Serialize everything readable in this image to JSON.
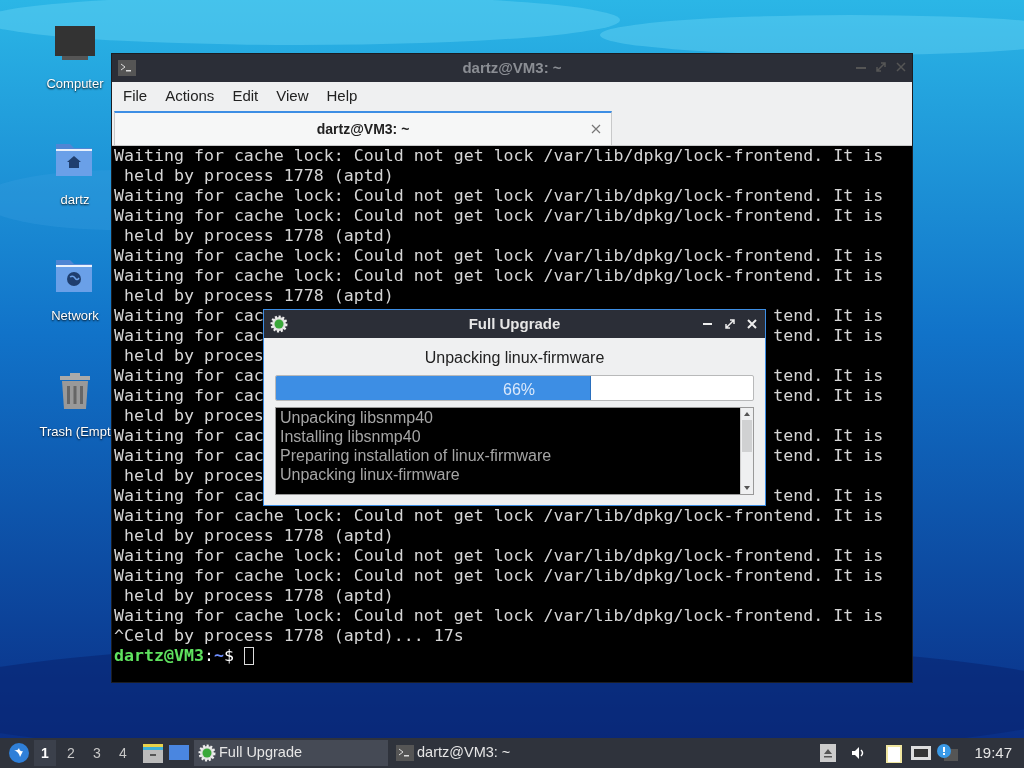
{
  "desktop_icons": [
    {
      "label": "Computer",
      "kind": "computer"
    },
    {
      "label": "dartz",
      "kind": "home"
    },
    {
      "label": "Network",
      "kind": "network"
    },
    {
      "label": "Trash (Empt",
      "kind": "trash"
    }
  ],
  "terminal": {
    "title": "dartz@VM3: ~",
    "menu": [
      "File",
      "Actions",
      "Edit",
      "View",
      "Help"
    ],
    "tab": {
      "label": "dartz@VM3: ~",
      "selected": true
    },
    "lines": [
      {
        "text": "Waiting for cache lock: Could not get lock /var/lib/dpkg/lock-frontend. It is"
      },
      {
        "text": " held by process 1778 (aptd)"
      },
      {
        "text": "Waiting for cache lock: Could not get lock /var/lib/dpkg/lock-frontend. It is"
      },
      {
        "text": "Waiting for cache lock: Could not get lock /var/lib/dpkg/lock-frontend. It is"
      },
      {
        "text": " held by process 1778 (aptd)"
      },
      {
        "text": "Waiting for cache lock: Could not get lock /var/lib/dpkg/lock-frontend. It is"
      },
      {
        "text": "Waiting for cache lock: Could not get lock /var/lib/dpkg/lock-frontend. It is"
      },
      {
        "text": " held by process 1778 (aptd)"
      },
      {
        "text": "Waiting for cac",
        "right": "tend. It is"
      },
      {
        "text": "Waiting for cac",
        "right": "tend. It is"
      },
      {
        "text": " held by proces"
      },
      {
        "text": "Waiting for cac",
        "right": "tend. It is"
      },
      {
        "text": "Waiting for cac",
        "right": "tend. It is"
      },
      {
        "text": " held by proces"
      },
      {
        "text": "Waiting for cac",
        "right": "tend. It is"
      },
      {
        "text": "Waiting for cac",
        "right": "tend. It is"
      },
      {
        "text": " held by proces"
      },
      {
        "text": "Waiting for cac",
        "right": "tend. It is"
      },
      {
        "text": "Waiting for cache lock: Could not get lock /var/lib/dpkg/lock-frontend. It is"
      },
      {
        "text": " held by process 1778 (aptd)"
      },
      {
        "text": "Waiting for cache lock: Could not get lock /var/lib/dpkg/lock-frontend. It is"
      },
      {
        "text": "Waiting for cache lock: Could not get lock /var/lib/dpkg/lock-frontend. It is"
      },
      {
        "text": " held by process 1778 (aptd)"
      },
      {
        "text": "Waiting for cache lock: Could not get lock /var/lib/dpkg/lock-frontend. It is"
      },
      {
        "text": "^Celd by process 1778 (aptd)... 17s"
      }
    ],
    "prompt": {
      "user_host": "dartz@VM3",
      "separator": ":",
      "path": "~",
      "symbol": "$"
    }
  },
  "dialog": {
    "title": "Full Upgrade",
    "status": "Unpacking linux-firmware",
    "progress": {
      "level": 0.66,
      "label": "66%"
    },
    "log": [
      "Unpacking libsnmp40",
      "Installing libsnmp40",
      "Preparing installation of linux-firmware",
      "Unpacking linux-firmware"
    ]
  },
  "taskbar": {
    "workspaces": [
      {
        "label": "1",
        "selected": true
      },
      {
        "label": "2",
        "selected": false
      },
      {
        "label": "3",
        "selected": false
      },
      {
        "label": "4",
        "selected": false
      }
    ],
    "tasks": [
      {
        "label": "Full Upgrade",
        "kind": "gear",
        "selected": true
      },
      {
        "label": "dartz@VM3: ~",
        "kind": "terminal",
        "selected": false
      }
    ],
    "clock": "19:47"
  }
}
